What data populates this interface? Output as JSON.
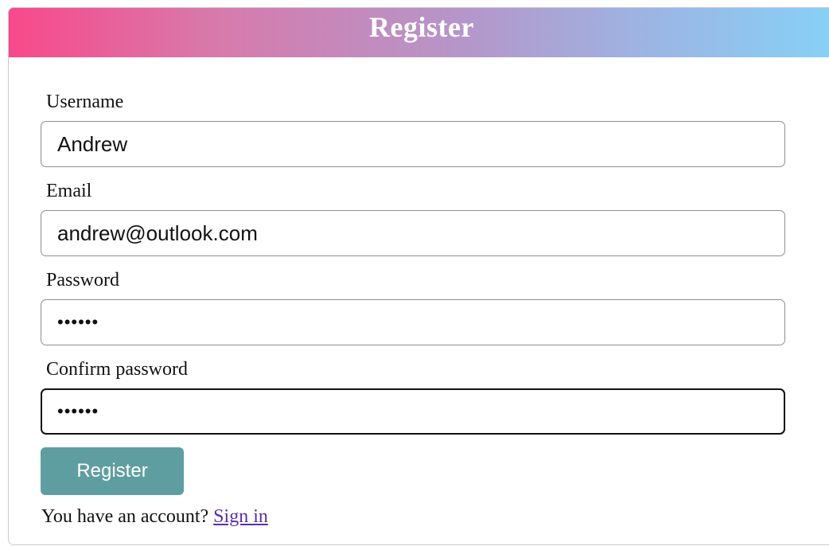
{
  "header": {
    "title": "Register"
  },
  "form": {
    "username": {
      "label": "Username",
      "value": "Andrew"
    },
    "email": {
      "label": "Email",
      "value": "andrew@outlook.com"
    },
    "password": {
      "label": "Password",
      "value": "••••••"
    },
    "confirm_password": {
      "label": "Confirm password",
      "value": "••••••"
    },
    "submit_label": "Register"
  },
  "footer": {
    "prompt": "You have an account?",
    "link_label": "Sign in"
  },
  "colors": {
    "gradient_start": "#f8498a",
    "gradient_end": "#86d1f7",
    "button": "#5f9ea0",
    "link": "#5a2ea6"
  }
}
